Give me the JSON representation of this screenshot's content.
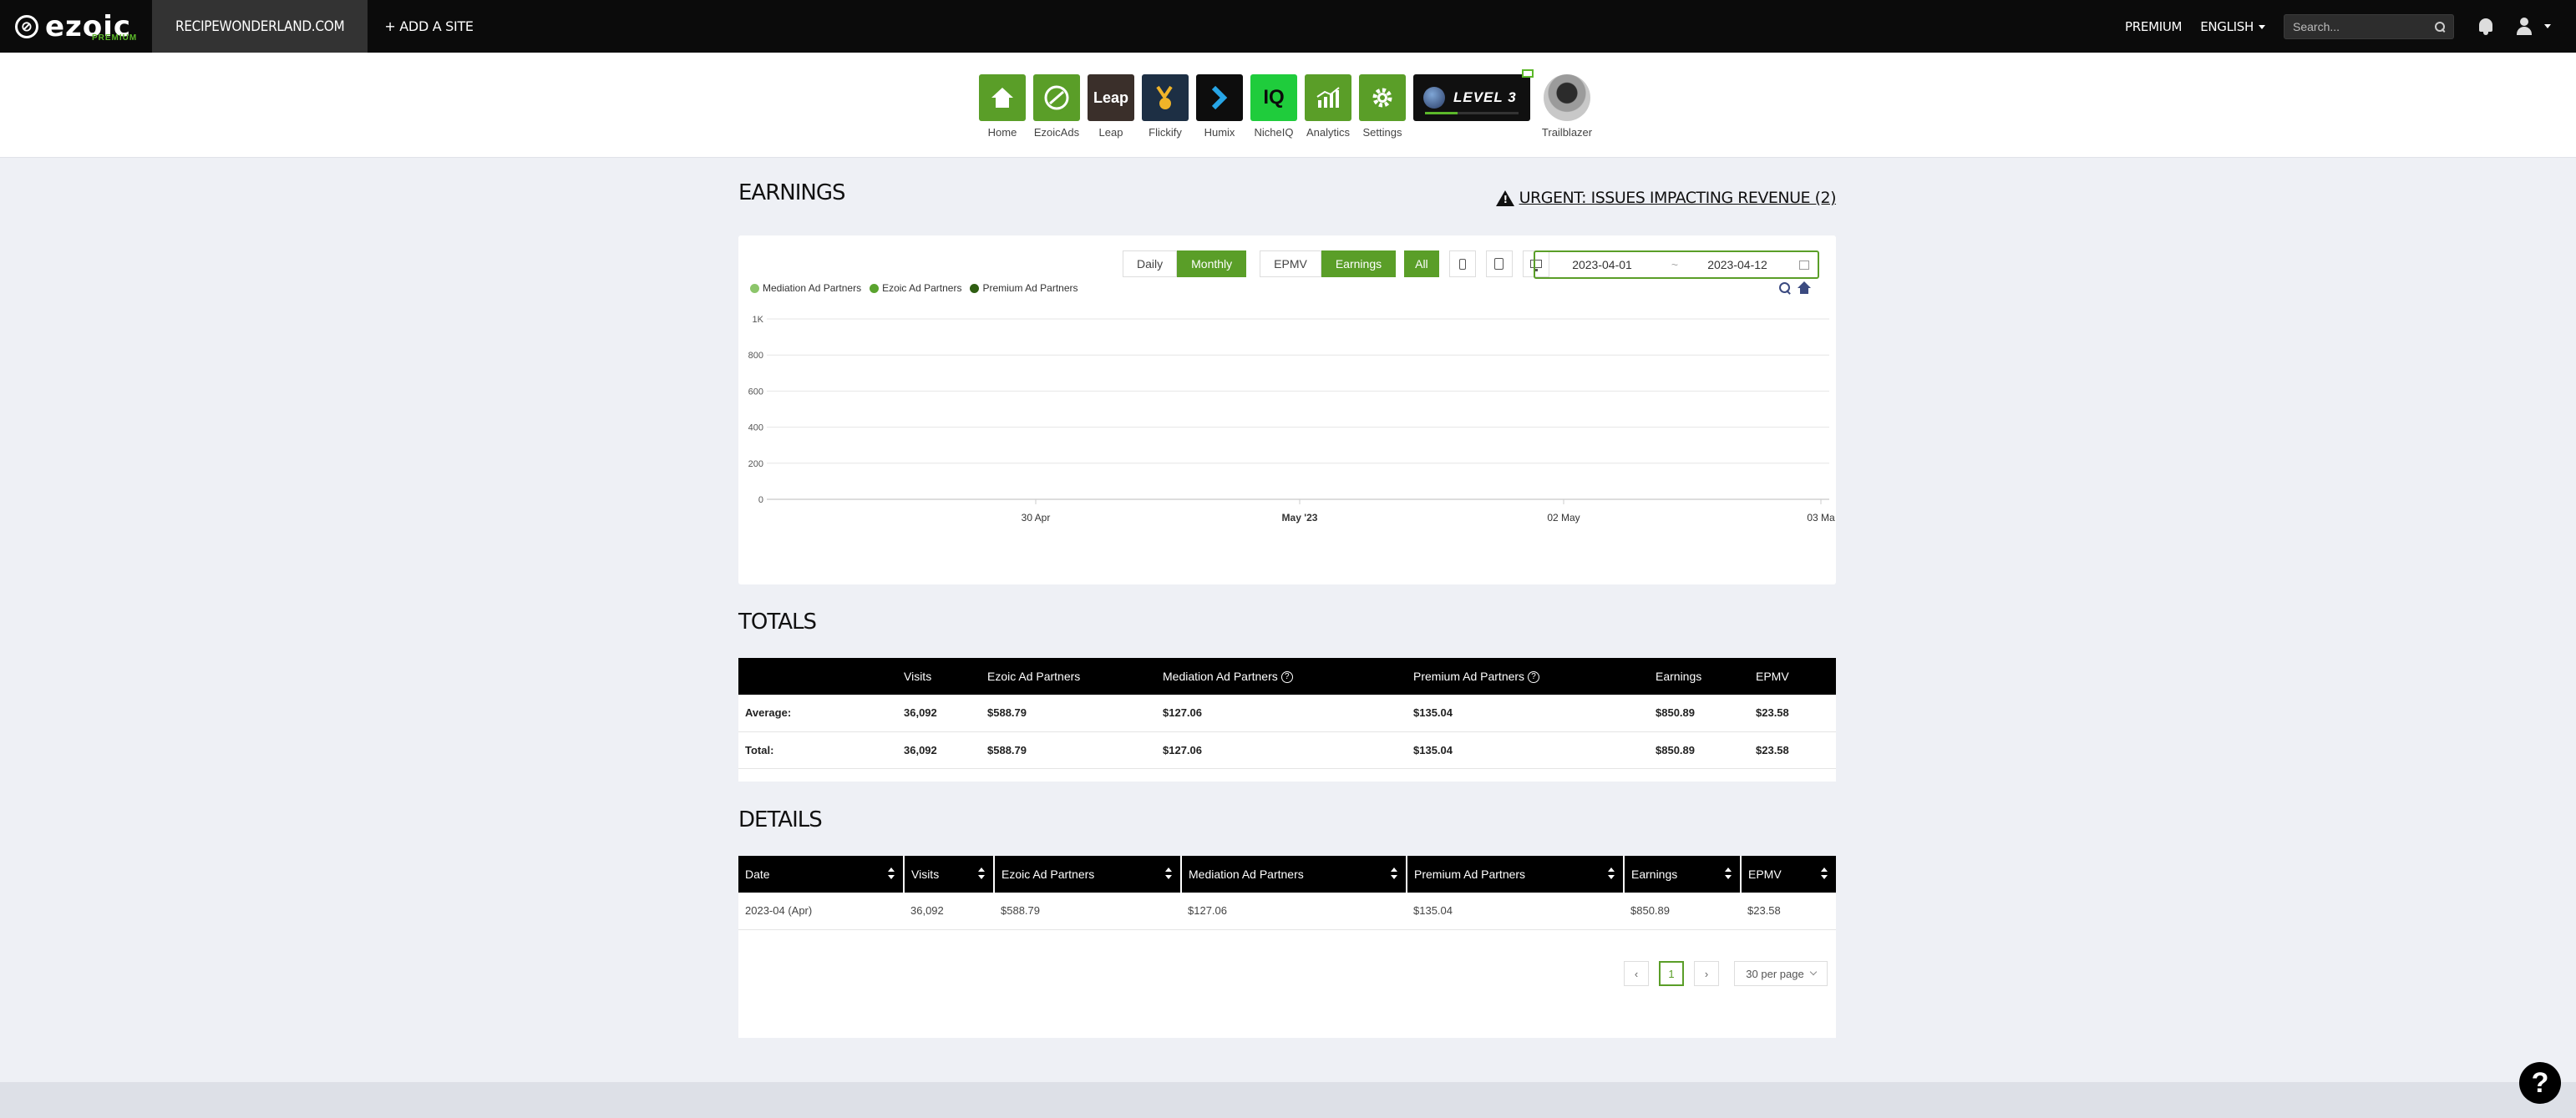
{
  "topbar": {
    "logo_text": "ezoic",
    "logo_sub": "PREMIUM",
    "site_name": "RECIPEWONDERLAND.COM",
    "add_site": "+ ADD A SITE",
    "premium": "PREMIUM",
    "language": "ENGLISH",
    "search_placeholder": "Search..."
  },
  "apps": [
    {
      "label": "Home",
      "icon": "house-icon"
    },
    {
      "label": "EzoicAds",
      "icon": "ezoicads-icon"
    },
    {
      "label": "Leap",
      "tile_text": "Leap",
      "icon": "leap-icon"
    },
    {
      "label": "Flickify",
      "icon": "flickify-icon"
    },
    {
      "label": "Humix",
      "icon": "humix-icon"
    },
    {
      "label": "NicheIQ",
      "tile_text": "IQ",
      "icon": "nicheiq-icon"
    },
    {
      "label": "Analytics",
      "icon": "analytics-icon"
    },
    {
      "label": "Settings",
      "icon": "gear-icon"
    }
  ],
  "level_badge": {
    "text": "LEVEL 3",
    "progress": 0.35
  },
  "trailblazer": {
    "label": "Trailblazer"
  },
  "earnings": {
    "title": "EARNINGS",
    "urgent": "URGENT: ISSUES IMPACTING REVENUE (2)",
    "period_buttons": [
      "Daily",
      "Monthly"
    ],
    "active_period": "Monthly",
    "metric_buttons": [
      "EPMV",
      "Earnings"
    ],
    "active_metric": "Earnings",
    "device_all": "All",
    "date_from": "2023-04-01",
    "date_sep": "~",
    "date_to": "2023-04-12"
  },
  "chart_data": {
    "type": "area",
    "legend": [
      {
        "name": "Mediation Ad Partners",
        "color": "#8cc56a"
      },
      {
        "name": "Ezoic Ad Partners",
        "color": "#5aa32e"
      },
      {
        "name": "Premium Ad Partners",
        "color": "#2f5e12"
      }
    ],
    "legend_position": "top-left",
    "y_ticks": [
      "0",
      "200",
      "400",
      "600",
      "800",
      "1K"
    ],
    "ylim": [
      0,
      1000
    ],
    "x_ticks": [
      "30 Apr",
      "May '23",
      "02 May",
      "03 Ma"
    ],
    "series": [],
    "grid": true
  },
  "totals": {
    "title": "TOTALS",
    "columns": [
      "",
      "Visits",
      "Ezoic Ad Partners",
      "Mediation Ad Partners",
      "Premium Ad Partners",
      "Earnings",
      "EPMV"
    ],
    "rows": [
      [
        "Average:",
        "36,092",
        "$588.79",
        "$127.06",
        "$135.04",
        "$850.89",
        "$23.58"
      ],
      [
        "Total:",
        "36,092",
        "$588.79",
        "$127.06",
        "$135.04",
        "$850.89",
        "$23.58"
      ]
    ]
  },
  "details": {
    "title": "DETAILS",
    "columns": [
      "Date",
      "Visits",
      "Ezoic Ad Partners",
      "Mediation Ad Partners",
      "Premium Ad Partners",
      "Earnings",
      "EPMV"
    ],
    "rows": [
      [
        "2023-04 (Apr)",
        "36,092",
        "$588.79",
        "$127.06",
        "$135.04",
        "$850.89",
        "$23.58"
      ]
    ],
    "current_page": "1",
    "per_page": "30 per page"
  },
  "help": "?"
}
